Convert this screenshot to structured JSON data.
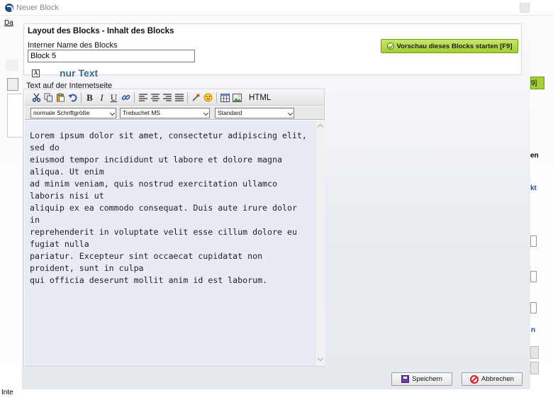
{
  "window": {
    "title": "Neuer Block"
  },
  "background_app": {
    "menu_fragment": "Da",
    "right_fragment_1": "en",
    "right_fragment_2": "kt",
    "right_fragment_3": "n",
    "status_fragment": "Inte",
    "button_fragment": "9]"
  },
  "layout_section": {
    "title": "Layout des Blocks - Inhalt des Blocks",
    "name_label": "Interner Name des Blocks",
    "name_value": "Block 5",
    "type_icon_label": "A",
    "type_label": "nur Text",
    "preview_button": "Vorschau dieses Blocks starten [F9]"
  },
  "editor": {
    "title": "Text auf der Internetseite",
    "toolbar": {
      "html_label": "HTML",
      "icons": [
        "cut-icon",
        "copy-icon",
        "paste-icon",
        "undo-icon",
        "bold-icon",
        "italic-icon",
        "underline-icon",
        "link-icon",
        "align-left-icon",
        "align-center-icon",
        "align-right-icon",
        "align-justify-icon",
        "clean-icon",
        "smiley-icon",
        "table-icon",
        "image-icon"
      ]
    },
    "font_size_select": "normale Schriftgröße",
    "font_family_select": "Trebuchet MS",
    "style_select": "Standard",
    "content": "Lorem ipsum dolor sit amet, consectetur adipiscing elit, sed do\neiusmod tempor incididunt ut labore et dolore magna aliqua. Ut enim\nad minim veniam, quis nostrud exercitation ullamco laboris nisi ut\naliquip ex ea commodo consequat. Duis aute irure dolor in\nreprehenderit in voluptate velit esse cillum dolore eu fugiat nulla\npariatur. Excepteur sint occaecat cupidatat non proident, sunt in culpa\nqui officia deserunt mollit anim id est laborum."
  },
  "buttons": {
    "save": "Speichern",
    "cancel": "Abbrechen"
  },
  "colors": {
    "type_label": "#3a6c8c",
    "preview_button": "#a6cf33",
    "editor_background": "#e8ebf3",
    "cancel_icon": "#d2202a",
    "save_icon": "#6b3fa0"
  }
}
